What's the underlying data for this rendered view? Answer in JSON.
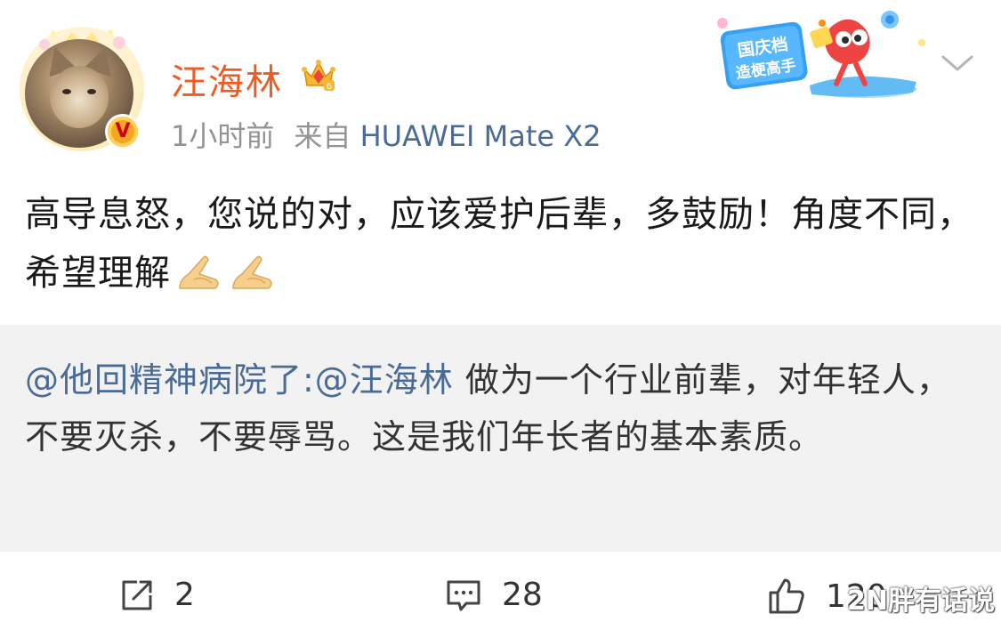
{
  "post": {
    "username": "汪海林",
    "time": "1小时前",
    "source_prefix": "来自",
    "source_device": "HUAWEI Mate X2",
    "content": "高导息怒，您说的对，应该爱护后辈，多鼓励！角度不同，希望理解",
    "vip_level": "6",
    "badge_line1": "国庆档",
    "badge_line2": "造梗高手",
    "verified_mark": "V"
  },
  "repost": {
    "mention_user": "@他回精神病院了:@汪海林",
    "text": " 做为一个行业前辈，对年轻人，不要灭杀，不要辱骂。这是我们年长者的基本素质。"
  },
  "actions": {
    "share_count": "2",
    "comment_count": "28",
    "like_count": "120"
  },
  "watermark": "2N胖有话说",
  "colors": {
    "username": "#f15a22",
    "link": "#4a6b96",
    "repost_bg": "#f2f2f2"
  }
}
